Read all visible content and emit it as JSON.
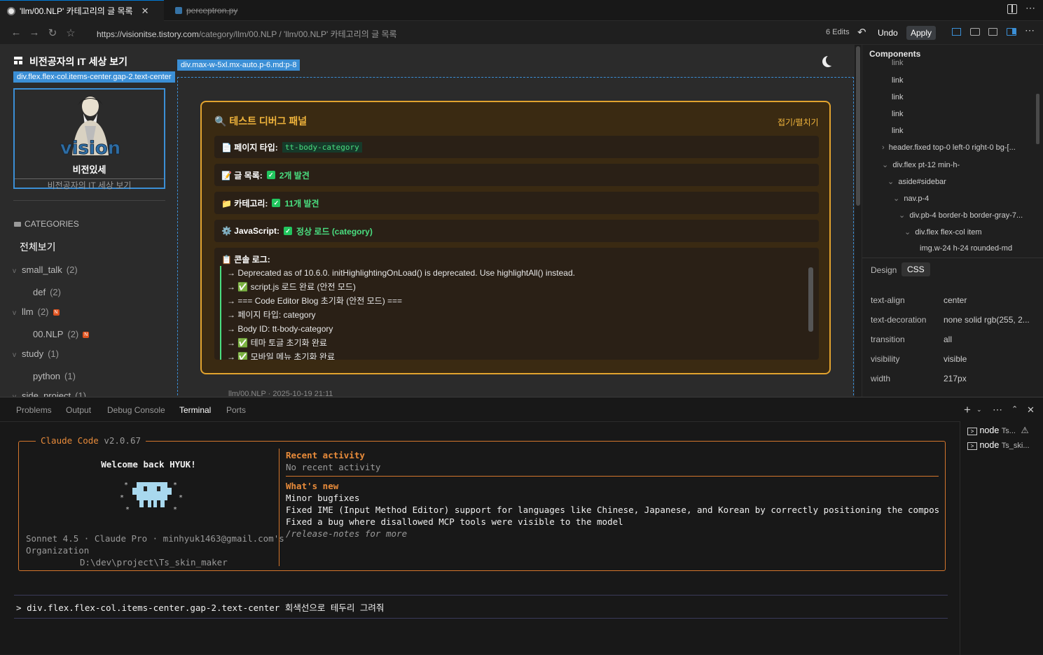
{
  "tabs": [
    {
      "label": "'llm/00.NLP' 카테고리의 글 목록",
      "active": true
    },
    {
      "label": "perceptron.py",
      "active": false
    }
  ],
  "address": {
    "url_host": "https://visionitse.tistory.com",
    "url_path": "/category/llm/00.NLP / 'llm/00.NLP' 카테고리의 글 목록",
    "edits": "6 Edits",
    "undo": "Undo",
    "apply": "Apply"
  },
  "preview": {
    "blog_title": "비전공자의 IT 세상 보기",
    "overlay_sidebar": "div.flex.flex-col.items-center.gap-2.text-center",
    "overlay_main": "div.max-w-5xl.mx-auto.p-6.md:p-8",
    "profile_name": "비전있세",
    "profile_sub": "비전공자의 IT 세상 보기",
    "logo_text": "vision",
    "categories_header": "CATEGORIES",
    "view_all": "전체보기",
    "categories": [
      {
        "label": "small_talk",
        "count": "(2)",
        "chevron": "v"
      },
      {
        "label": "def",
        "count": "(2)",
        "chevron": ""
      },
      {
        "label": "llm",
        "count": "(2)",
        "chevron": "v",
        "new": "N"
      },
      {
        "label": "00.NLP",
        "count": "(2)",
        "chevron": "",
        "new": "N"
      },
      {
        "label": "study",
        "count": "(1)",
        "chevron": "v"
      },
      {
        "label": "python",
        "count": "(1)",
        "chevron": ""
      },
      {
        "label": "side_project",
        "count": "(1)",
        "chevron": "v"
      }
    ],
    "debug": {
      "title": "🔍 테스트 디버그 패널",
      "toggle": "접기/펼치기",
      "rows": [
        {
          "label": "📄 페이지 타입:",
          "value": "tt-body-category"
        },
        {
          "label": "📝 글 목록:",
          "value": "2개 발견"
        },
        {
          "label": "📁 카테고리:",
          "value": "11개 발견"
        },
        {
          "label": "⚙️ JavaScript:",
          "value": "정상 로드 (category)"
        }
      ],
      "console_title": "📋 콘솔 로그:",
      "logs": [
        "→ Deprecated as of 10.6.0. initHighlightingOnLoad() is deprecated. Use highlightAll() instead.",
        "→ ✅ script.js 로드 완료 (안전 모드)",
        "→ === Code Editor Blog 초기화 (안전 모드) ===",
        "→ 페이지 타입: category",
        "→ Body ID: tt-body-category",
        "→ ✅ 테마 토글 초기화 완료",
        "→ ✅ 모바일 메뉴 초기화 완료"
      ]
    },
    "post_meta": "llm/00.NLP · 2025-10-19 21:11"
  },
  "devtools": {
    "title": "Components",
    "tree": [
      {
        "label": "link",
        "indent": 0
      },
      {
        "label": "link",
        "indent": 0
      },
      {
        "label": "link",
        "indent": 0
      },
      {
        "label": "link",
        "indent": 0
      },
      {
        "label": "link",
        "indent": 0
      },
      {
        "label": "header.fixed top-0 left-0 right-0 bg-[...",
        "indent": 1
      },
      {
        "label": "div.flex pt-12 min-h-",
        "indent": 2
      },
      {
        "label": "aside#sidebar",
        "indent": 3
      },
      {
        "label": "nav.p-4",
        "indent": 4
      },
      {
        "label": "div.pb-4 border-b border-gray-7...",
        "indent": 5
      },
      {
        "label": "div.flex flex-col item",
        "indent": 6
      },
      {
        "label": "img.w-24 h-24 rounded-md",
        "indent": 7
      }
    ],
    "tab_design": "Design",
    "tab_css": "CSS",
    "props": [
      {
        "name": "text-align",
        "value": "center"
      },
      {
        "name": "text-decoration",
        "value": "none solid rgb(255, 2..."
      },
      {
        "name": "transition",
        "value": "all"
      },
      {
        "name": "visibility",
        "value": "visible"
      },
      {
        "name": "width",
        "value": "217px"
      }
    ]
  },
  "panel": {
    "tabs": [
      "Problems",
      "Output",
      "Debug Console",
      "Terminal",
      "Ports"
    ],
    "active_tab": "Terminal",
    "terminals": [
      {
        "name": "node",
        "detail": "Ts..."
      },
      {
        "name": "node",
        "detail": "Ts_ski..."
      }
    ]
  },
  "claude": {
    "header_name": "Claude Code",
    "header_version": "v2.0.67",
    "welcome": "Welcome back HYUK!",
    "account_line1": "Sonnet 4.5 · Claude Pro · minhyuk1463@gmail.com's",
    "account_line2": "Organization",
    "cwd": "D:\\dev\\project\\Ts_skin_maker",
    "recent_title": "Recent activity",
    "recent_text": "No recent activity",
    "whatsnew_title": "What's new",
    "whatsnew": [
      "Minor bugfixes",
      "Fixed IME (Input Method Editor) support for languages like Chinese, Japanese, and Korean by correctly positioning the composition wi…",
      "Fixed a bug where disallowed MCP tools were visible to the model"
    ],
    "release_notes": "/release-notes for more",
    "prompt_symbol": ">",
    "prompt_text": "div.flex.flex-col.items-center.gap-2.text-center 회색선으로 테두리 그려줘"
  },
  "colors": {
    "accent": "#e2a32e",
    "success": "#4ade80",
    "claude_orange": "#d4762c",
    "selection_blue": "#3b8fd6"
  }
}
